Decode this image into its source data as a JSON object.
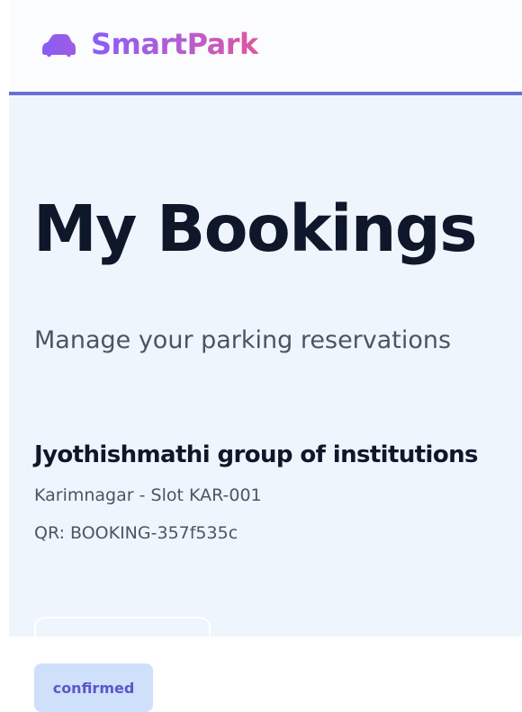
{
  "header": {
    "brand": "SmartPark",
    "logo_icon": "car-icon",
    "accent_color": "#6b6fd4",
    "brand_gradient": [
      "#8b5cf6",
      "#e0569e"
    ]
  },
  "page": {
    "title": "My Bookings",
    "subtitle": "Manage your parking reservations"
  },
  "bookings": [
    {
      "name": "Jyothishmathi group of institutions",
      "location": "Karimnagar - Slot KAR-001",
      "qr": "QR: BOOKING-357f535c",
      "status": "confirmed"
    }
  ]
}
